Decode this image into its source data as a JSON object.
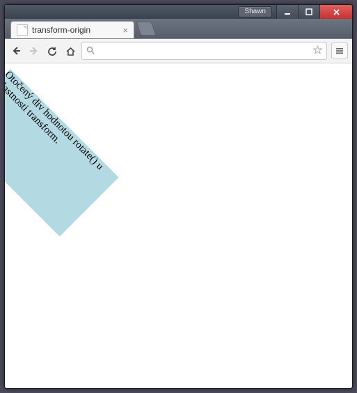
{
  "os": {
    "user_tag": "Shawn"
  },
  "tab": {
    "title": "transform-origin"
  },
  "omnibox": {
    "placeholder": "",
    "value": ""
  },
  "page": {
    "rotated_text": "Otočený div hodnotou rotate() u vlastnosti transform."
  }
}
